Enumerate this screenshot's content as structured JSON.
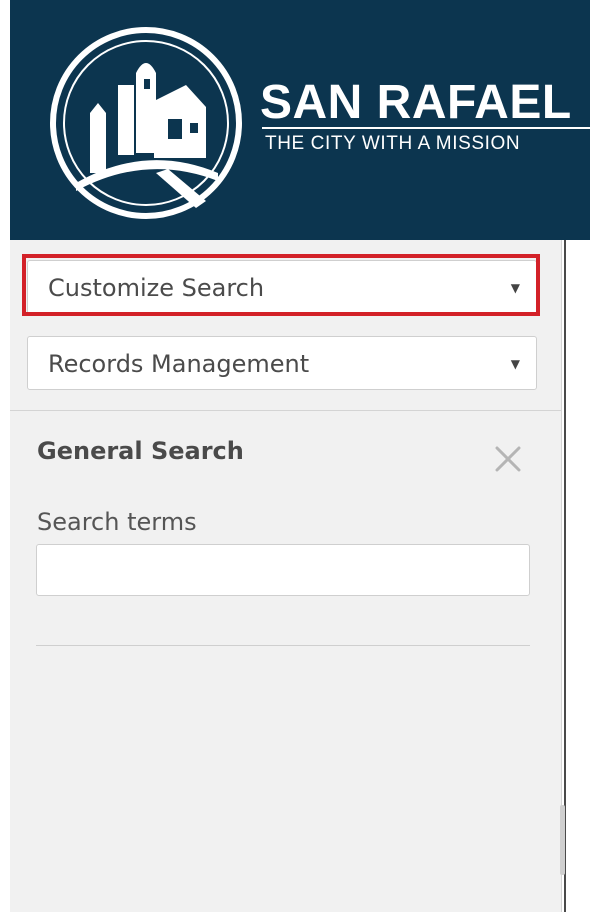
{
  "header": {
    "brand_title": "SAN RAFAEL",
    "brand_tagline": "THE CITY WITH A MISSION",
    "logo_icon": "city-seal-icon",
    "background_color": "#0c354f"
  },
  "sidebar": {
    "search_type_dropdown": {
      "selected": "Customize Search",
      "icon": "caret-down-icon",
      "highlight_color": "#d32128"
    },
    "repository_dropdown": {
      "selected": "Records Management",
      "icon": "caret-down-icon"
    },
    "general_search": {
      "title": "General Search",
      "close_icon": "close-icon",
      "search_terms_label": "Search terms",
      "search_terms_value": ""
    }
  }
}
